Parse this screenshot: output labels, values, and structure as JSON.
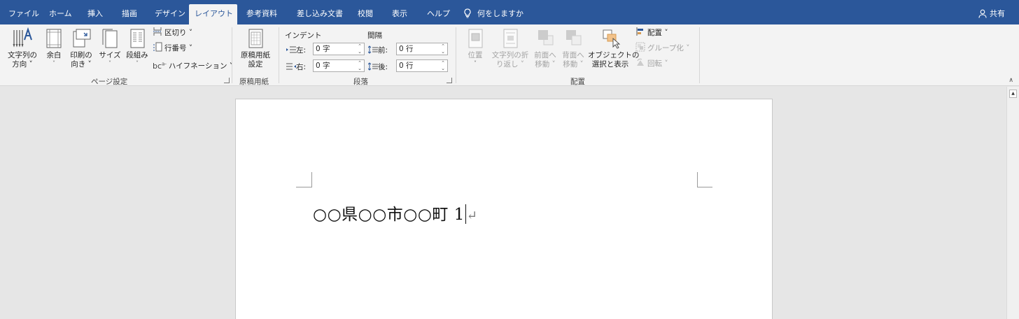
{
  "tabs": [
    "ファイル",
    "ホーム",
    "挿入",
    "描画",
    "デザイン",
    "レイアウト",
    "参考資料",
    "差し込み文書",
    "校閲",
    "表示",
    "ヘルプ"
  ],
  "active_tab": "レイアウト",
  "tell_me": "何をしますか",
  "share": "共有",
  "ribbon": {
    "page_setup": {
      "label": "ページ設定",
      "text_direction": [
        "文字列の",
        "方向 ˅"
      ],
      "margins": [
        "余白",
        "˅"
      ],
      "orientation": [
        "印刷の",
        "向き ˅"
      ],
      "size": [
        "サイズ",
        "˅"
      ],
      "columns": [
        "段組み",
        "˅"
      ],
      "breaks": "区切り ˅",
      "line_numbers": "行番号 ˅",
      "hyphenation": "ハイフネーション ˅"
    },
    "manuscript": {
      "label": "原稿用紙",
      "button": [
        "原稿用紙",
        "設定"
      ]
    },
    "paragraph": {
      "label": "段落",
      "indent_title": "インデント",
      "spacing_title": "間隔",
      "left_label": "左:",
      "right_label": "右:",
      "before_label": "前:",
      "after_label": "後:",
      "left_value": "0 字",
      "right_value": "0 字",
      "before_value": "0 行",
      "after_value": "0 行"
    },
    "arrange": {
      "label": "配置",
      "position": [
        "位置",
        "˅"
      ],
      "wrap_text": [
        "文字列の折",
        "り返し ˅"
      ],
      "bring_forward": [
        "前面へ",
        "移動 ˅"
      ],
      "send_backward": [
        "背面へ",
        "移動 ˅"
      ],
      "selection_pane": [
        "オブジェクトの",
        "選択と表示"
      ],
      "align": "配置 ˅",
      "group": "グループ化 ˅",
      "rotate": "回転 ˅"
    }
  },
  "document": {
    "text": "○○県○○市○○町 1",
    "paragraph_mark": "↵"
  },
  "colors": {
    "title_bar": "#2b579a",
    "ribbon_bg": "#f3f3f3",
    "canvas_bg": "#e6e6e6"
  }
}
